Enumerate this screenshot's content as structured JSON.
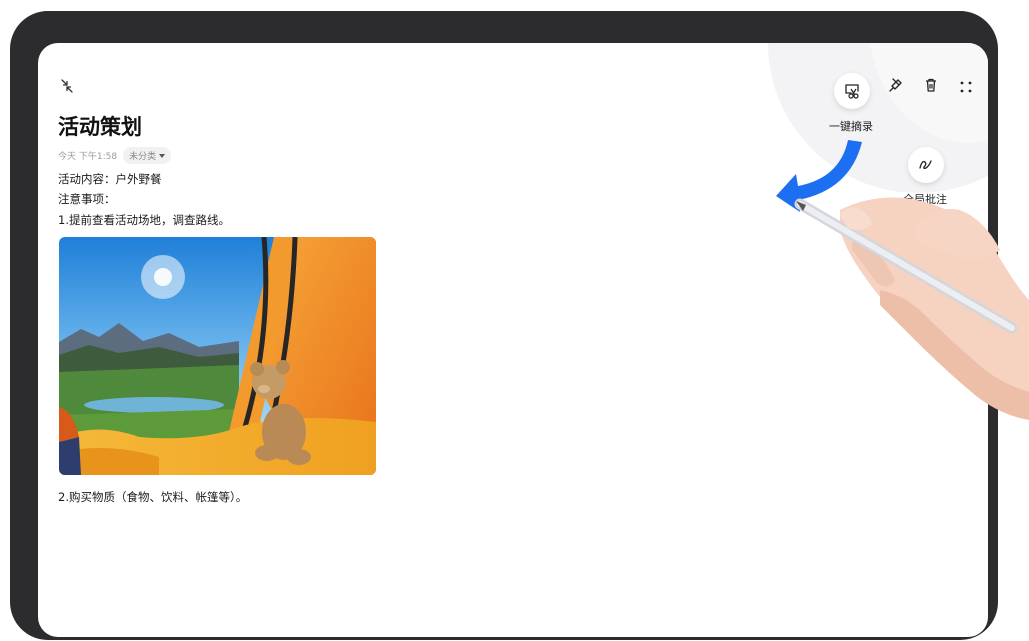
{
  "note": {
    "title": "活动策划",
    "timestamp": "今天 下午1:58",
    "category": "未分类",
    "lines": [
      "活动内容：户外野餐",
      "注意事项：",
      "1.提前查看活动场地，调查路线。"
    ],
    "after_image": "2.购买物质（食物、饮料、帐篷等）。"
  },
  "toolbar": {
    "icons": [
      "pin-icon",
      "trash-icon",
      "more-icon"
    ]
  },
  "quick_menu": {
    "capture_label": "一键摘录",
    "annotate_label": "全局批注"
  },
  "colors": {
    "accent_blue": "#1d6ff2",
    "frame": "#2c2c2e"
  }
}
